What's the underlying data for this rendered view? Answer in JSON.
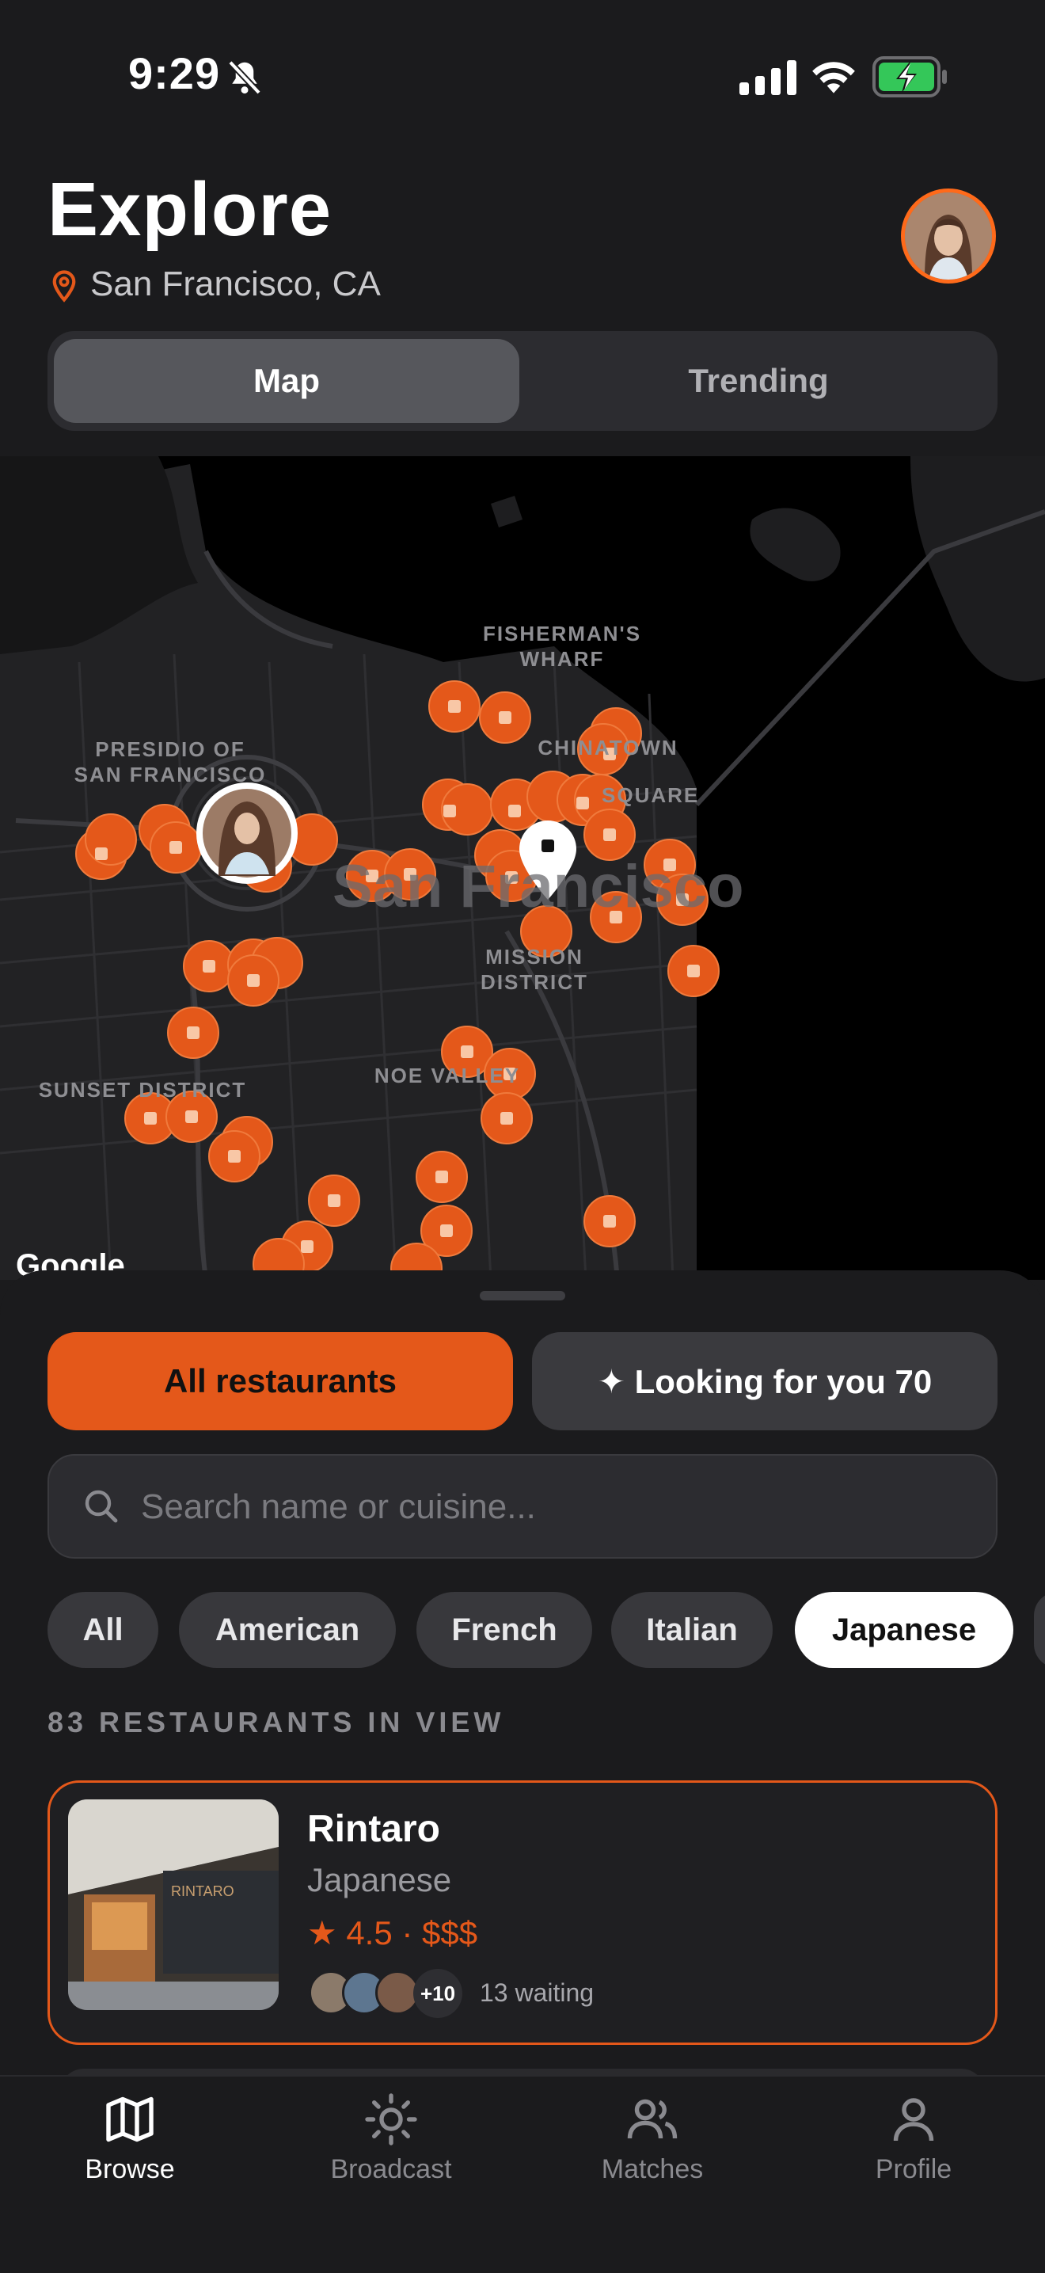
{
  "status_bar": {
    "time": "9:29"
  },
  "header": {
    "title": "Explore",
    "location": "San Francisco, CA"
  },
  "segmented": {
    "map_label": "Map",
    "trending_label": "Trending",
    "selected": "Map"
  },
  "map": {
    "labels": {
      "fishermans_wharf": "FISHERMAN'S\nWHARF",
      "presidio": "PRESIDIO OF\nSAN FRANCISCO",
      "chinatown": "CHINATOWN",
      "square": "SQUARE",
      "mission": "MISSION\nDISTRICT",
      "sunset": "SUNSET DISTRICT",
      "noe_valley": "NOE VALLEY",
      "city": "San Francisco",
      "attribution": "Google"
    },
    "accent": "#e4581a"
  },
  "filters": {
    "all_restaurants": "All restaurants",
    "looking_for_you": "✦ Looking for you 70",
    "selected": "All restaurants"
  },
  "search": {
    "placeholder": "Search name or cuisine..."
  },
  "cuisines": [
    "All",
    "American",
    "French",
    "Italian",
    "Japanese"
  ],
  "cuisine_selected": "Japanese",
  "results": {
    "count_label": "83 RESTAURANTS IN VIEW"
  },
  "restaurants": [
    {
      "name": "Rintaro",
      "cuisine": "Japanese",
      "rating_line": "★ 4.5 · $$$",
      "waiting_more": "+10",
      "waiting_text": "13 waiting",
      "sign_text": "RINTARO"
    }
  ],
  "tabbar": {
    "browse": "Browse",
    "broadcast": "Broadcast",
    "matches": "Matches",
    "profile": "Profile",
    "active": "Browse"
  }
}
